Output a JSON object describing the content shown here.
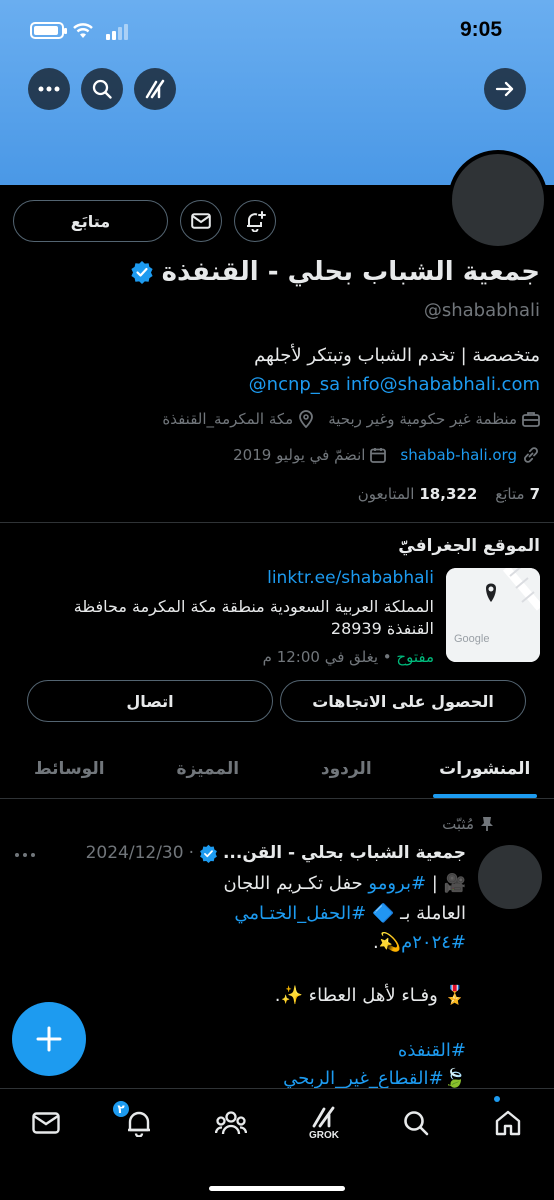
{
  "status_bar": {
    "time": "9:05"
  },
  "profile": {
    "name": "جمعية الشباب بحلي - القنفذة",
    "handle": "@shababhali",
    "bio_line1": "متخصصة | تخدم الشباب وتبتكر لأجلهم",
    "bio_line2": "@ncnp_sa info@shababhali.com",
    "category": "منظمة غير حكومية وغير ربحية",
    "location": "مكة المكرمة_القنفذة",
    "website": "shabab-hali.org",
    "joined": "انضمّ في يوليو 2019",
    "following_count": "7",
    "following_label": "متابَع",
    "followers_count": "18,322",
    "followers_label": "المتابعون",
    "follow_button": "متابَع"
  },
  "location_card": {
    "title": "الموقع الجغرافيّ",
    "link": "linktr.ee/shababhali",
    "address": "المملكة العربية السعودية منطقة مكة المكرمة محافظة القنفذة 28939",
    "status_open": "مفتوح",
    "status_rest": " • يغلق في 12:00 م",
    "map_brand": "Google",
    "directions_button": "الحصول على الاتجاهات",
    "call_button": "اتصال"
  },
  "tabs": [
    {
      "label": "المنشورات",
      "active": true
    },
    {
      "label": "الردود",
      "active": false
    },
    {
      "label": "المميزة",
      "active": false
    },
    {
      "label": "الوسائط",
      "active": false
    }
  ],
  "post": {
    "pinned_label": "مُثبّت",
    "author": "جمعية الشباب بحلي - القن...",
    "date": "2024/12/30",
    "line1_emoji": "🎥",
    "line1_hash": "#برومو",
    "line1_text": " حفل تكـريم اللجان",
    "line2_text": "العاملة بـ 🔷 ",
    "line2_hash": "#الحفل_الختـامي",
    "line3_hash": "#٢٠٢٤م",
    "line3_text": "💫.",
    "line4_text": "🎖️ وفـاء لأهل العطاء ✨.",
    "line5_hash": "#القنفذه",
    "line6_emoji": "🍃",
    "line6_hash": "#القطاع_غير_الربحي"
  },
  "bottom_nav": {
    "grok_label": "GROK",
    "notifications_badge": "٢"
  },
  "colors": {
    "accent": "#1d9bf0",
    "banner": "#4a98e6",
    "open": "#00ba7c"
  }
}
